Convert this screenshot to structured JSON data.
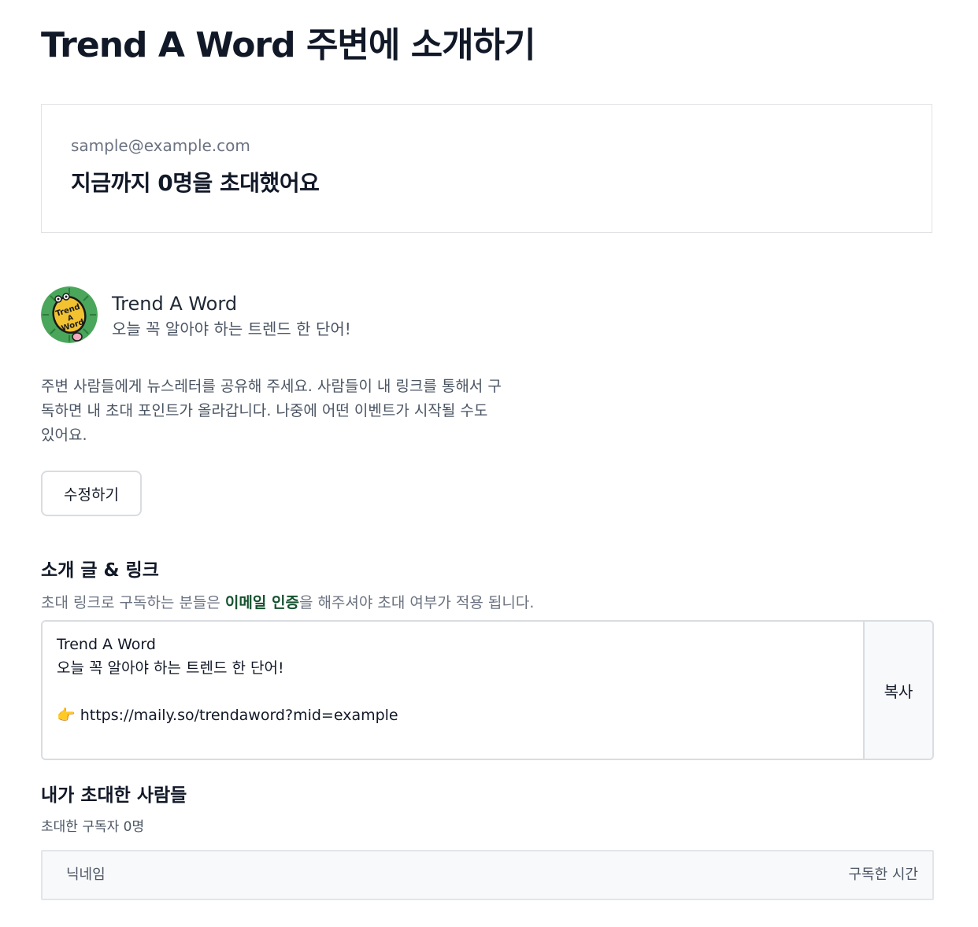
{
  "page": {
    "title": "Trend A Word 주변에 소개하기"
  },
  "stats": {
    "email": "sample@example.com",
    "invited_summary": "지금까지 0명을 초대했어요"
  },
  "newsletter": {
    "name": "Trend A Word",
    "description": "오늘 꼭 알아야 하는 트렌드 한 단어!",
    "logo_text": "Trend A Word",
    "logo_color": "#4aa65a"
  },
  "intro": {
    "text": "주변 사람들에게 뉴스레터를 공유해 주세요. 사람들이 내 링크를 통해서 구독하면 내 초대 포인트가 올라갑니다. 나중에 어떤 이벤트가 시작될 수도 있어요."
  },
  "edit_button": {
    "label": "수정하기"
  },
  "share_section": {
    "title": "소개 글 & 링크",
    "note_before": "초대 링크로 구독하는 분들은 ",
    "note_emphasis": "이메일 인증",
    "note_after": "을 해주셔야 초대 여부가 적용 됩니다.",
    "share_text": "Trend A Word\n오늘 꼭 알아야 하는 트렌드 한 단어!\n\n👉 https://maily.so/trendaword?mid=example",
    "copy_label": "복사"
  },
  "invited": {
    "title": "내가 초대한 사람들",
    "count_text": "초대한 구독자 0명",
    "columns": {
      "nickname": "닉네임",
      "subscribed_time": "구독한 시간"
    }
  },
  "colors": {
    "accent_text": "#15522f",
    "border": "#d9dce1",
    "muted": "#6b7280"
  }
}
